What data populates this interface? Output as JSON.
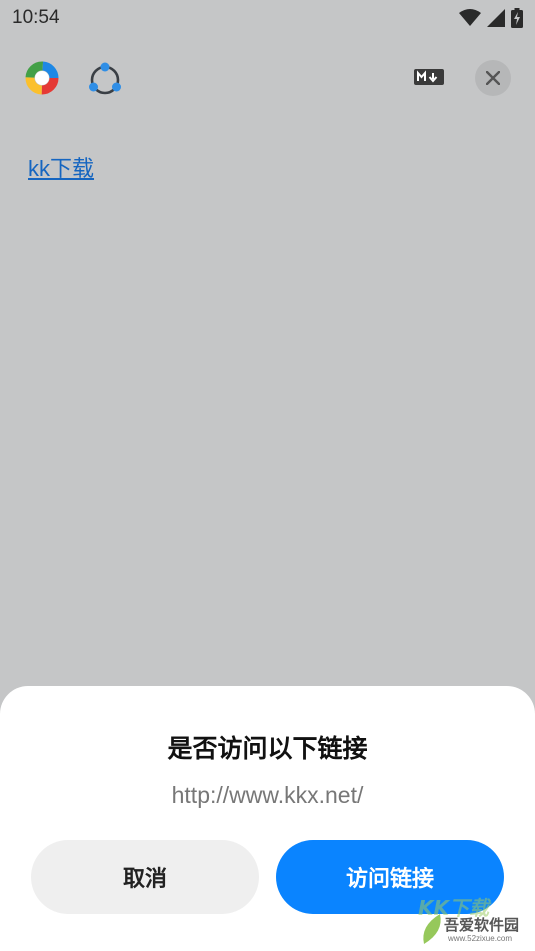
{
  "status_bar": {
    "time": "10:54",
    "icons": [
      "wifi-icon",
      "signal-icon",
      "battery-charging-icon"
    ]
  },
  "toolbar": {
    "icons": [
      "color-wheel-logo-icon",
      "share-nodes-icon",
      "markdown-icon",
      "close-icon"
    ]
  },
  "page": {
    "link_text": "kk下载"
  },
  "dialog": {
    "title": "是否访问以下链接",
    "url": "http://www.kkx.net/",
    "cancel_label": "取消",
    "confirm_label": "访问链接",
    "confirm_color": "#0a84ff"
  },
  "watermark": {
    "brand": "KK下载",
    "main": "吾爱软件园",
    "sub": "www.52zixue.com"
  }
}
